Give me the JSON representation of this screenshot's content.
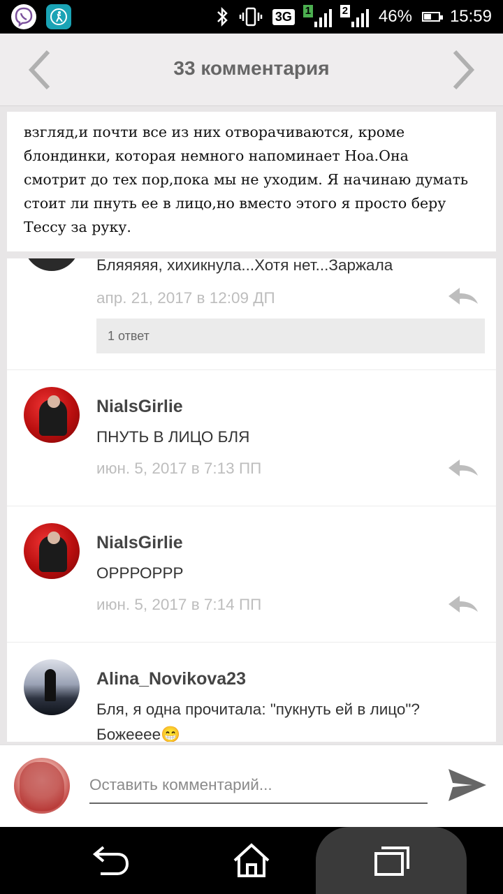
{
  "status_bar": {
    "left_icons": [
      "viber-icon",
      "fitness-app-icon"
    ],
    "right_icons": [
      "bluetooth-icon",
      "vibrate-icon"
    ],
    "network": "3G",
    "sim1": "1",
    "sim2": "2",
    "battery": "46%",
    "time": "15:59"
  },
  "header": {
    "title": "33 комментария",
    "prev_icon": "chevron-left-icon",
    "next_icon": "chevron-right-icon"
  },
  "story": {
    "lines": [
      "взгляд,и почти все из них отворачиваются, кроме",
      "блондинки, которая немного напоминает Ноа.Она",
      "смотрит до тех пор,пока мы не уходим. Я начинаю думать",
      "стоит ли пнуть ее в лицо,но вместо этого я просто беру",
      "Тессу за руку."
    ]
  },
  "comments": [
    {
      "text": "Бляяяяя, хихикнула...Хотя нет...Заржала",
      "date": "апр. 21, 2017 в 12:09 ДП",
      "replies_label": "1 ответ"
    },
    {
      "author": "NialsGirlie",
      "text": "ПНУТЬ В ЛИЦО БЛЯ",
      "date": "июн. 5, 2017 в 7:13 ПП"
    },
    {
      "author": "NialsGirlie",
      "text": "ОРРРОРРР",
      "date": "июн. 5, 2017 в 7:14 ПП"
    },
    {
      "author": "Alina_Novikova23",
      "text_line1": "Бля, я одна прочитала: \"пукнуть ей в лицо\"?",
      "text_line2": "Божееее😁"
    }
  ],
  "composer": {
    "placeholder": "Оставить комментарий...",
    "send_icon": "send-icon"
  },
  "nav_bar": {
    "icons": [
      "back-icon",
      "home-icon",
      "recents-icon"
    ]
  },
  "colors": {
    "header_bg": "#efedee",
    "page_bg": "#e8e6e7",
    "date_text": "#bdbdbd",
    "replies_bg": "#ebebeb"
  }
}
